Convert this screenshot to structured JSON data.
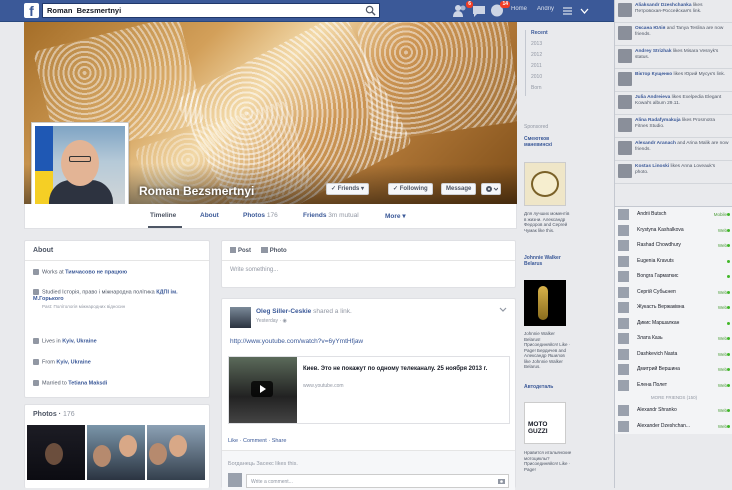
{
  "topbar": {
    "search_value": "Roman  Bezsmertnyi",
    "home_label": "Home",
    "user_label": "Andriy",
    "friend_requests_count": "6",
    "notifications_count": "14"
  },
  "profile": {
    "name": "Roman Bezsmertnyi",
    "buttons": {
      "friends": "✓ Friends",
      "following": "✓ Following",
      "message": "Message"
    }
  },
  "tabs": [
    {
      "label": "Timeline",
      "count": ""
    },
    {
      "label": "About",
      "count": ""
    },
    {
      "label": "Photos",
      "count": "176"
    },
    {
      "label": "Friends",
      "count": "3m mutual"
    },
    {
      "label": "More ▾",
      "count": ""
    }
  ],
  "about": {
    "title": "About",
    "rows": [
      {
        "text": "Works at ",
        "bold": "Тимчасово не працюю",
        "sub": ""
      },
      {
        "text": "Studied Історія, право і міжнародна політика ",
        "bold": "КДПІ ім. М.Горького",
        "sub": "Past: Політологія міжнародних відносин"
      },
      {
        "text": "Lives in ",
        "bold": "Kyiv, Ukraine",
        "sub": ""
      },
      {
        "text": "From ",
        "bold": "Kyiv, Ukraine",
        "sub": ""
      },
      {
        "text": "Married to ",
        "bold": "Tetiana Maksdi",
        "sub": ""
      }
    ]
  },
  "photos_card": {
    "title": "Photos",
    "count": "176"
  },
  "composer": {
    "post_tab": "Post",
    "photo_tab": "Photo",
    "placeholder": "Write something..."
  },
  "post": {
    "author": "Oleg Siller-Ceskie",
    "shared": "shared a link.",
    "time": "Yesterday",
    "url": "http://www.youtube.com/watch?v=6yYmtHfjaw",
    "link_title": "Киев. Это не покажут по одному телеканалу. 25 ноября 2013 г.",
    "link_domain": "www.youtube.com",
    "actions": "Like · Comment · Share",
    "likes_text": "Богданець Засекс likes this.",
    "comment_placeholder": "Write a comment..."
  },
  "right_rail": {
    "years": [
      "Recent",
      "2013",
      "2012",
      "2011",
      "2010",
      "Born"
    ],
    "sponsored_label": "Sponsored",
    "ads": [
      {
        "title": "Смеютков маневинскі",
        "text": "Для лучших моментів в жизни. Александр Федоров and Сергей Чумак like this."
      },
      {
        "title": "Johnnie Walker Belarus",
        "text": "Johnnie Walker Belarus! Присоединяйся! Like · Page! Бердичев and Александр Яшилов like Johnnie Walker Belarus."
      },
      {
        "title": "Автодеталь",
        "text": "Нравится итальянские мотоциклы? Присоединяйся! Like · Page!"
      }
    ]
  },
  "ticker": [
    {
      "name": "Aliaksandr Dzeshchanka",
      "text": "likes Петровская-Россейская's link."
    },
    {
      "name": "Оксана Юлія",
      "text": "and Tanya Teslina are now friends."
    },
    {
      "name": "Andrey Strizhak",
      "text": "likes Misara Vesnyk's status."
    },
    {
      "name": "Віктор Кущенко",
      "text": "likes Юрий Мусук's link."
    },
    {
      "name": "Julia Andreieva",
      "text": "likes Exelpedia Elegant Kowal's album 29.11."
    },
    {
      "name": "Alina Radafymakuja",
      "text": "likes Prosmotra Fitnes Studio."
    },
    {
      "name": "Alexandr Aranach",
      "text": "and Arina Malik are now friends."
    },
    {
      "name": "Kostas Linoski",
      "text": "likes Anna Loveauk's photo."
    }
  ],
  "chat": {
    "online": [
      {
        "name": "Andrii Butsch",
        "status": "Mobile"
      },
      {
        "name": "Krystyna Kashalkova",
        "status": "Web"
      },
      {
        "name": "Rashad Chowdhury",
        "status": "Web"
      },
      {
        "name": "Eugenia Kravuts",
        "status": ""
      },
      {
        "name": "Bongra Гарматкис",
        "status": ""
      },
      {
        "name": "Сергій Субьєнеп",
        "status": "Web"
      },
      {
        "name": "Жукасть Вержаківна",
        "status": "Web"
      },
      {
        "name": "Дикис Маршалкан",
        "status": ""
      },
      {
        "name": "Злата Казь",
        "status": "Web"
      },
      {
        "name": "Dashkevich Nasta",
        "status": "Web"
      },
      {
        "name": "Дмитрий Вершина",
        "status": "Web"
      },
      {
        "name": "Елена Полет",
        "status": "Web"
      }
    ],
    "more_label": "MORE FRIENDS (150)",
    "more": [
      {
        "name": "Alexandr Shranko",
        "status": "Web"
      },
      {
        "name": "Alexander Dzeshchan...",
        "status": "Web"
      }
    ]
  }
}
